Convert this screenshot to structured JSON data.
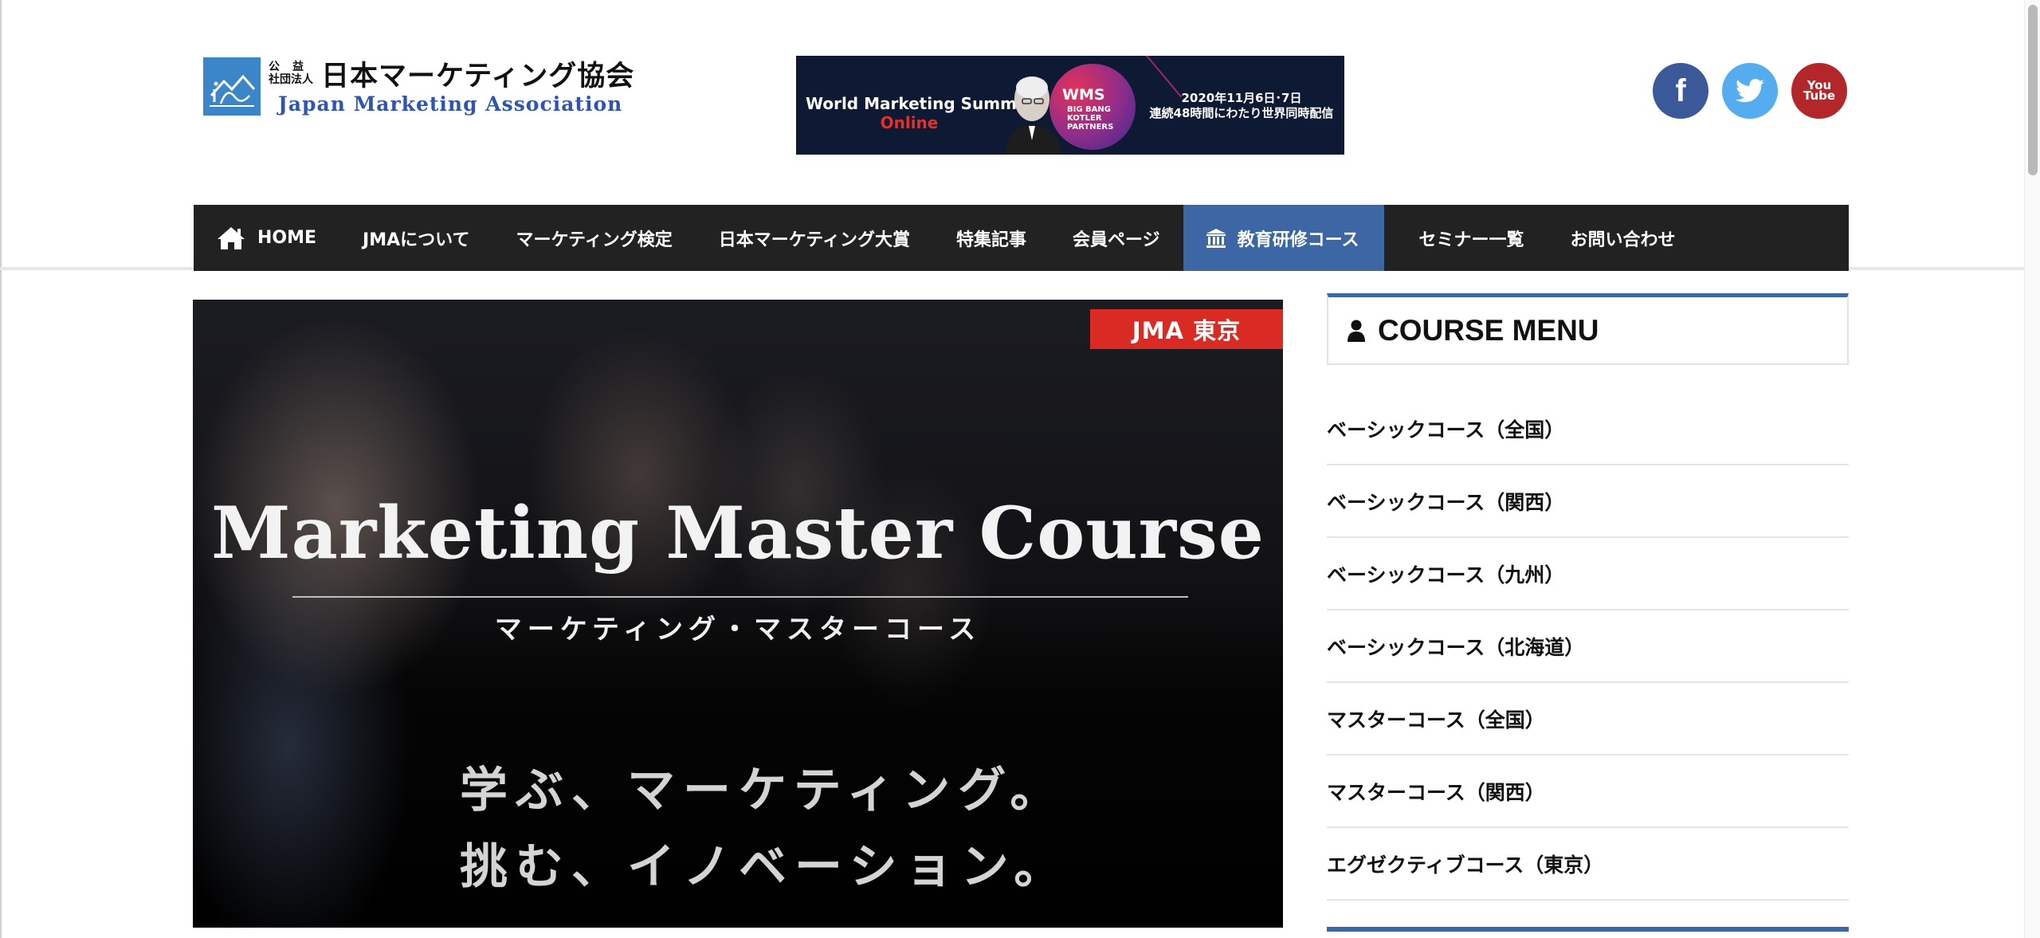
{
  "header": {
    "logo": {
      "small_line1": "公益",
      "small_line2": "社団法人",
      "name_jp": "日本マーケティング協会",
      "name_en": "Japan Marketing Association"
    },
    "banner": {
      "title": "World Marketing Summit",
      "subtitle": "Online",
      "wms": "WMS",
      "badge_line1": "BIG BANG",
      "badge_line2": "KOTLER",
      "badge_line3": "PARTNERS",
      "date": "2020年11月6日･7日",
      "description": "連続48時間にわたり世界同時配信"
    },
    "social": {
      "facebook_glyph": "f",
      "youtube_line1": "You",
      "youtube_line2": "Tube"
    }
  },
  "nav": {
    "items": [
      {
        "label": "HOME",
        "icon": "home-icon"
      },
      {
        "label": "JMAについて"
      },
      {
        "label": "マーケティング検定"
      },
      {
        "label": "日本マーケティング大賞"
      },
      {
        "label": "特集記事"
      },
      {
        "label": "会員ページ"
      },
      {
        "label": "教育研修コース",
        "icon": "institution-icon",
        "active": true
      },
      {
        "label": "セミナー一覧"
      },
      {
        "label": "お問い合わせ"
      }
    ],
    "colors": {
      "bar": "#222222",
      "active": "#3c66a4"
    }
  },
  "hero": {
    "tag": "JMA 東京",
    "title": "Marketing Master Course",
    "subtitle": "マーケティング・マスターコース",
    "copy_line1": "学ぶ、マーケティング。",
    "copy_line2": "挑む、イノベーション。",
    "tag_color": "#d92b24"
  },
  "sidebar": {
    "menu_title": "COURSE MENU",
    "menu_icon": "user-icon",
    "items": [
      {
        "label": "ベーシックコース（全国）"
      },
      {
        "label": "ベーシックコース（関西）"
      },
      {
        "label": "ベーシックコース（九州）"
      },
      {
        "label": "ベーシックコース（北海道）"
      },
      {
        "label": "マスターコース（全国）"
      },
      {
        "label": "マスターコース（関西）"
      },
      {
        "label": "エグゼクティブコース（東京）"
      }
    ],
    "accent_color": "#3c66a4"
  }
}
